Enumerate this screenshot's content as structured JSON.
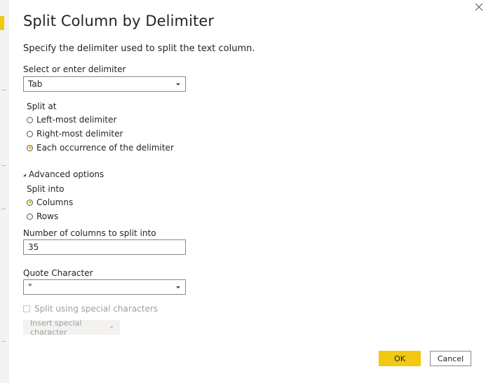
{
  "dialog": {
    "title": "Split Column by Delimiter",
    "subtitle": "Specify the delimiter used to split the text column."
  },
  "delimiter": {
    "label": "Select or enter delimiter",
    "value": "Tab"
  },
  "split_at": {
    "label": "Split at",
    "options": [
      {
        "label": "Left-most delimiter",
        "checked": false
      },
      {
        "label": "Right-most delimiter",
        "checked": false
      },
      {
        "label": "Each occurrence of the delimiter",
        "checked": true
      }
    ]
  },
  "advanced": {
    "label": "Advanced options",
    "split_into_label": "Split into",
    "split_into_options": [
      {
        "label": "Columns",
        "checked": true
      },
      {
        "label": "Rows",
        "checked": false
      }
    ],
    "num_columns_label": "Number of columns to split into",
    "num_columns_value": "35",
    "quote_label": "Quote Character",
    "quote_value": "\"",
    "special_chars_label": "Split using special characters",
    "insert_special_label": "Insert special character"
  },
  "buttons": {
    "ok": "OK",
    "cancel": "Cancel"
  },
  "colors": {
    "accent": "#f2c811",
    "border": "#8a8886",
    "disabled_text": "#a19f9d"
  }
}
